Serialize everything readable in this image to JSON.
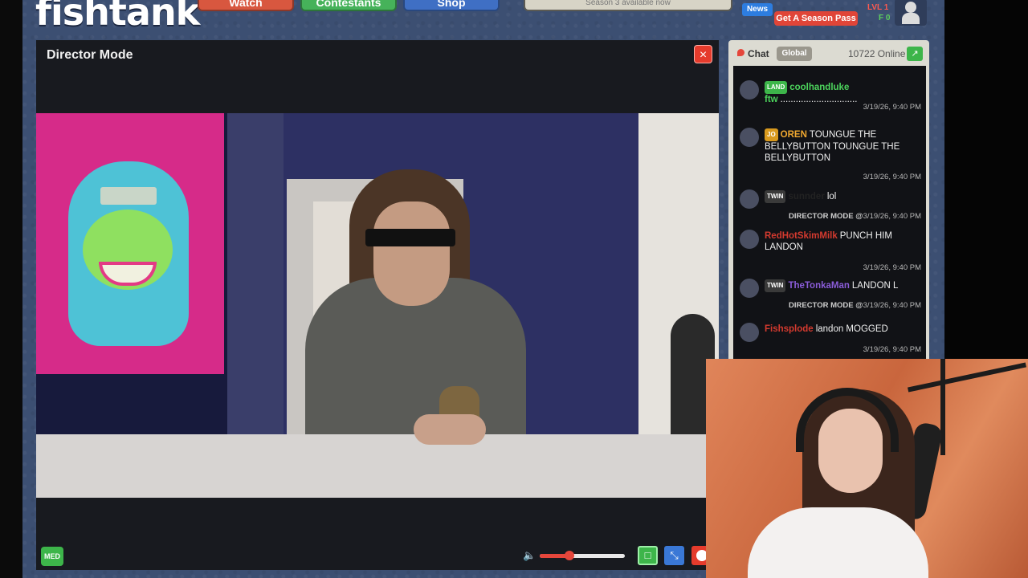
{
  "header": {
    "logo": "fishtank",
    "logo_mark": "©",
    "nav": [
      {
        "label": "Watch",
        "icon": "tv-icon"
      },
      {
        "label": "Contestants",
        "icon": "people-icon"
      },
      {
        "label": "Shop",
        "icon": "star-icon"
      }
    ],
    "status_text": "Season 3 available now",
    "news_label": "News",
    "season_pass_label": "Get A Season Pass",
    "level": "LVL 1",
    "fish_count": "F 0"
  },
  "director": {
    "title": "Director Mode",
    "close_symbol": "×",
    "quality_label": "MED",
    "volume_level": 0.35,
    "controls": [
      "fit-screen-icon",
      "fullscreen-icon",
      "record-icon"
    ]
  },
  "chat": {
    "title": "Chat",
    "tab_label": "Global",
    "online_count": "10722 Online",
    "messages": [
      {
        "tag": "LAND",
        "tag_color": "#3db54a",
        "name": "coolhandluke ftw",
        "name_color": "#4cd35c",
        "text": "..............................",
        "time": "3/19/26, 9:40 PM",
        "dm": ""
      },
      {
        "tag": "JO",
        "tag_color": "#d99a1e",
        "name": "OREN",
        "name_color": "#f0a830",
        "text": "TOUNGUE THE BELLYBUTTON TOUNGUE THE BELLYBUTTON",
        "time": "3/19/26, 9:40 PM",
        "dm": ""
      },
      {
        "tag": "TWIN",
        "tag_color": "#3a3a3a",
        "name": "sunnder",
        "name_color": "#222222",
        "text": "lol",
        "time": "3/19/26, 9:40 PM",
        "dm": "DIRECTOR MODE @"
      },
      {
        "tag": "",
        "tag_color": "",
        "name": "RedHotSkimMilk",
        "name_color": "#d43a2f",
        "text": "PUNCH HIM LANDON",
        "time": "3/19/26, 9:40 PM",
        "dm": ""
      },
      {
        "tag": "TWIN",
        "tag_color": "#3a3a3a",
        "name": "TheTonkaMan",
        "name_color": "#8a5cd8",
        "text": "LANDON L",
        "time": "3/19/26, 9:40 PM",
        "dm": "DIRECTOR MODE @"
      },
      {
        "tag": "",
        "tag_color": "",
        "name": "Fishsplode",
        "name_color": "#d43a2f",
        "text": "landon MOGGED",
        "time": "3/19/26, 9:40 PM",
        "dm": ""
      }
    ]
  },
  "colors": {
    "accent_red": "#e53b2c",
    "accent_green": "#3db54a",
    "accent_blue": "#3a78d6"
  }
}
